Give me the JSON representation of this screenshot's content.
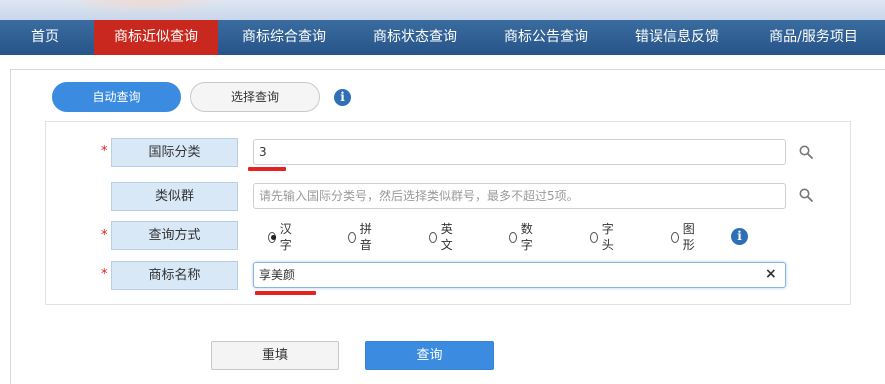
{
  "nav": {
    "items": [
      {
        "label": "首页",
        "active": false
      },
      {
        "label": "商标近似查询",
        "active": true
      },
      {
        "label": "商标综合查询",
        "active": false
      },
      {
        "label": "商标状态查询",
        "active": false
      },
      {
        "label": "商标公告查询",
        "active": false
      },
      {
        "label": "错误信息反馈",
        "active": false
      },
      {
        "label": "商品/服务项目",
        "active": false
      }
    ]
  },
  "tabs": {
    "auto": "自动查询",
    "select": "选择查询"
  },
  "form": {
    "required_mark": "*",
    "intl_class": {
      "label": "国际分类",
      "value": "3"
    },
    "similar_group": {
      "label": "类似群",
      "placeholder": "请先输入国际分类号，然后选择类似群号，最多不超过5项。"
    },
    "query_method": {
      "label": "查询方式",
      "options": [
        "汉字",
        "拼音",
        "英文",
        "数字",
        "字头",
        "图形"
      ],
      "selected": "汉字"
    },
    "trademark_name": {
      "label": "商标名称",
      "value": "享美颜"
    }
  },
  "buttons": {
    "reset": "重填",
    "query": "查询"
  },
  "icons": {
    "info": "i",
    "clear": "×"
  },
  "colors": {
    "nav_bg": "#2d5d93",
    "nav_active": "#c8281d",
    "primary": "#3b8be0",
    "label_bg": "#d9e8f7",
    "required": "#d8221c",
    "annotation": "#e42222"
  }
}
